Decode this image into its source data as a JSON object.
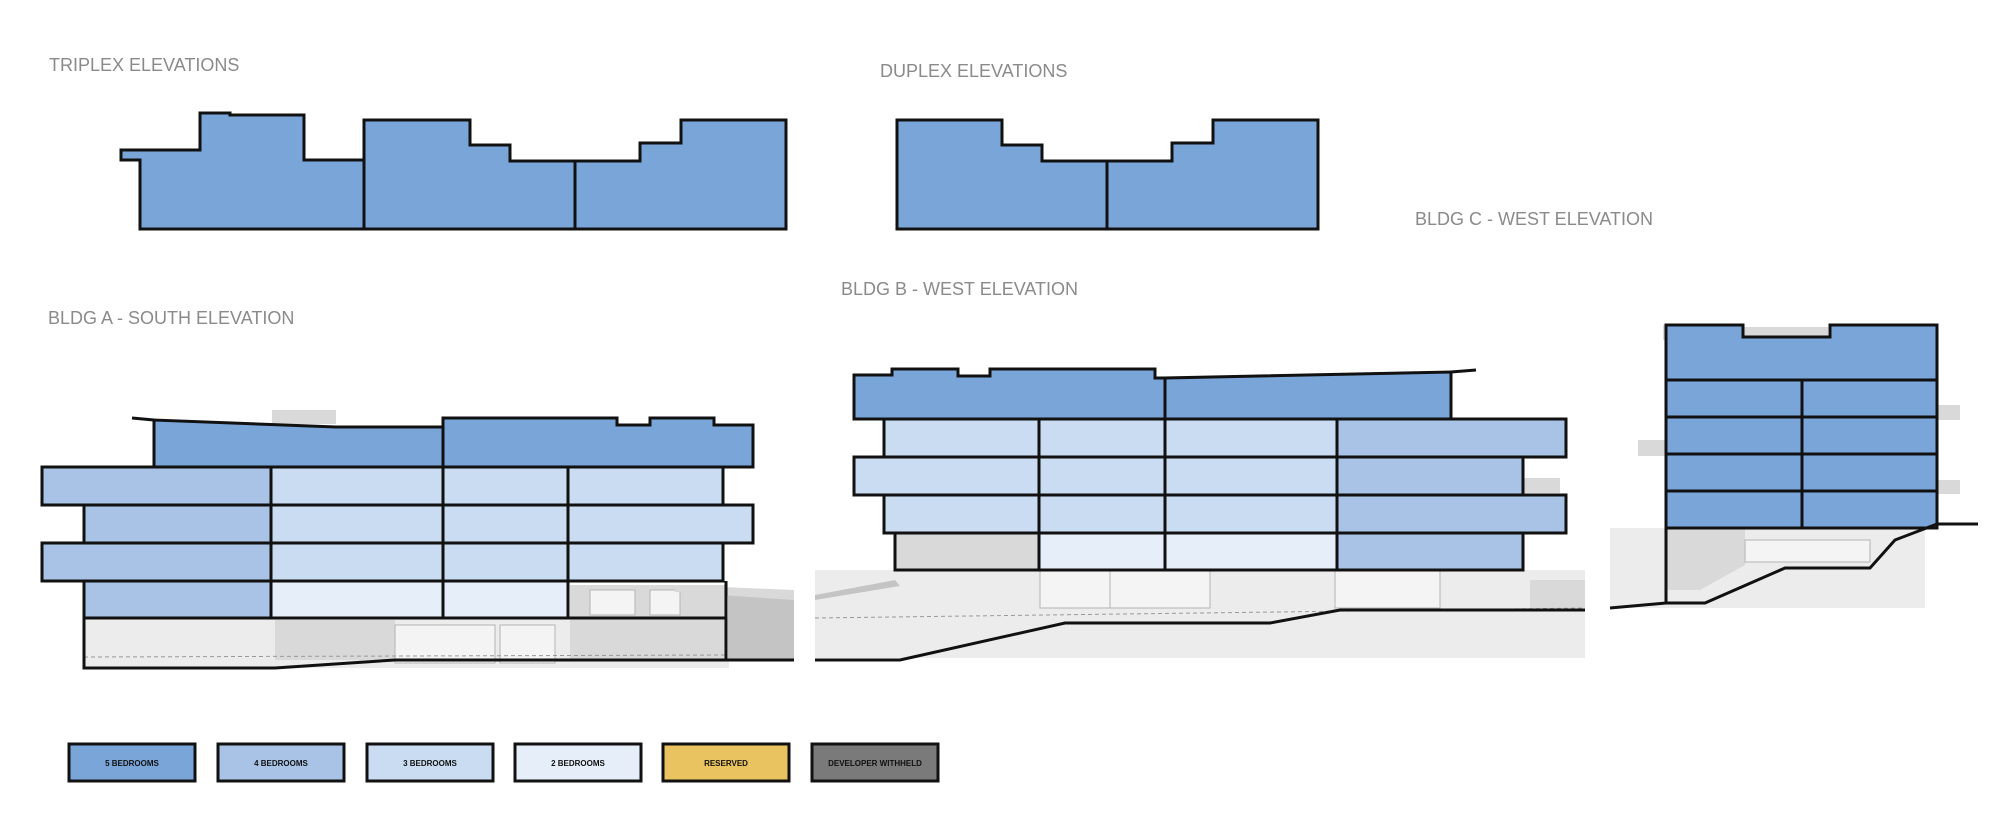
{
  "titles": {
    "triplex": "TRIPLEX ELEVATIONS",
    "duplex": "DUPLEX ELEVATIONS",
    "bldg_a": "BLDG A - SOUTH ELEVATION",
    "bldg_b": "BLDG B - WEST ELEVATION",
    "bldg_c": "BLDG C - WEST ELEVATION"
  },
  "legend": [
    {
      "key": "5br",
      "label": "5 BEDROOMS",
      "color": "#7aa5d9"
    },
    {
      "key": "4br",
      "label": "4 BEDROOMS",
      "color": "#a9c3e7"
    },
    {
      "key": "3br",
      "label": "3 BEDROOMS",
      "color": "#cadcf1"
    },
    {
      "key": "2br",
      "label": "2 BEDROOMS",
      "color": "#e6eef9"
    },
    {
      "key": "reserved",
      "label": "RESERVED",
      "color": "#e9c35f"
    },
    {
      "key": "withheld",
      "label": "DEVELOPER WITHHELD",
      "color": "#7a7a7a"
    }
  ]
}
